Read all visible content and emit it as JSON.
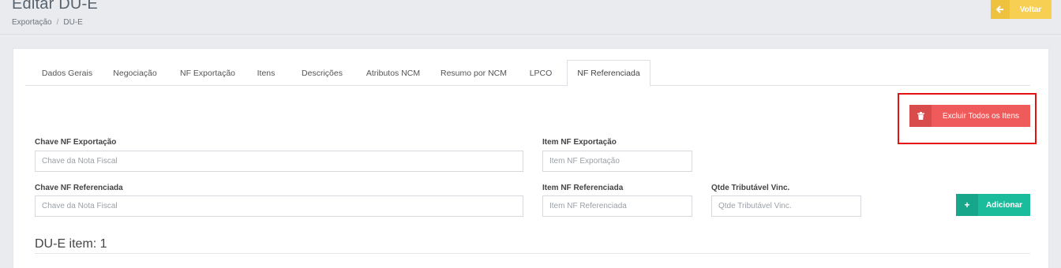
{
  "header": {
    "title": "Editar DU-E",
    "breadcrumb": [
      "Exportação",
      "DU-E"
    ],
    "back_button": "Voltar"
  },
  "tabs": [
    {
      "label": "Dados Gerais"
    },
    {
      "label": "Negociação"
    },
    {
      "label": "NF Exportação"
    },
    {
      "label": "Itens"
    },
    {
      "label": "Descrições"
    },
    {
      "label": "Atributos NCM"
    },
    {
      "label": "Resumo por NCM"
    },
    {
      "label": "LPCO"
    },
    {
      "label": "NF Referenciada",
      "active": true
    }
  ],
  "actions": {
    "delete_all": "Excluir Todos os Itens",
    "add": "Adicionar"
  },
  "form": {
    "chave_nf_exportacao": {
      "label": "Chave NF Exportação",
      "placeholder": "Chave da Nota Fiscal"
    },
    "item_nf_exportacao": {
      "label": "Item NF Exportação",
      "placeholder": "Item NF Exportação"
    },
    "chave_nf_referenciada": {
      "label": "Chave NF Referenciada",
      "placeholder": "Chave da Nota Fiscal"
    },
    "item_nf_referenciada": {
      "label": "Item NF Referenciada",
      "placeholder": "Item NF Referenciada"
    },
    "qtde_tributavel": {
      "label": "Qtde Tributável Vinc.",
      "placeholder": "Qtde Tributável Vinc."
    }
  },
  "section": {
    "title": "DU-E item: 1"
  },
  "colors": {
    "back_button": "#f6cf53",
    "delete_button": "#ef5b5b",
    "add_button": "#1abc9c",
    "highlight": "#e41212"
  }
}
